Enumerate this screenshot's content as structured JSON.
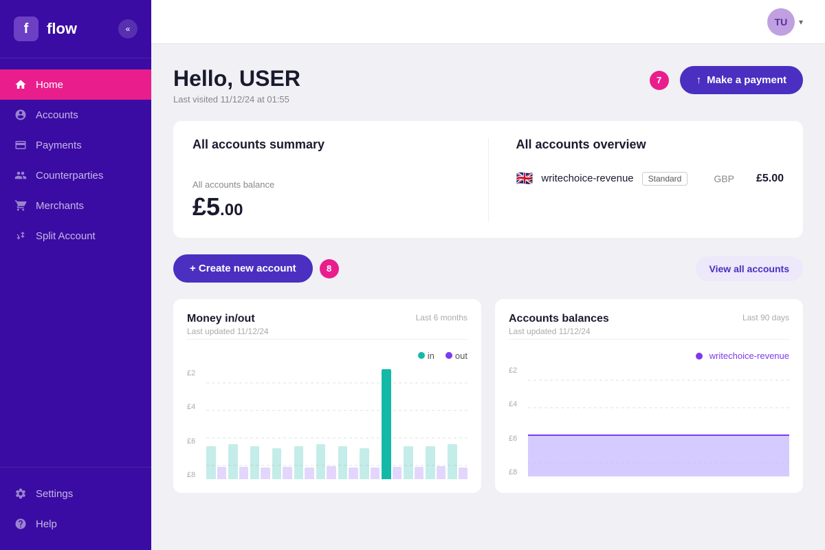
{
  "sidebar": {
    "logo": "f",
    "app_name": "flow",
    "collapse_label": "<<",
    "nav_items": [
      {
        "id": "home",
        "label": "Home",
        "icon": "home",
        "active": true
      },
      {
        "id": "accounts",
        "label": "Accounts",
        "icon": "accounts"
      },
      {
        "id": "payments",
        "label": "Payments",
        "icon": "payments"
      },
      {
        "id": "counterparties",
        "label": "Counterparties",
        "icon": "counterparties"
      },
      {
        "id": "merchants",
        "label": "Merchants",
        "icon": "merchants"
      },
      {
        "id": "split-account",
        "label": "Split Account",
        "icon": "split"
      }
    ],
    "bottom_items": [
      {
        "id": "settings",
        "label": "Settings",
        "icon": "settings"
      },
      {
        "id": "help",
        "label": "Help",
        "icon": "help"
      }
    ]
  },
  "header": {
    "user_initials": "TU",
    "user_chevron": "▾"
  },
  "hero": {
    "greeting": "Hello, USER",
    "last_visited": "Last visited 11/12/24 at 01:55",
    "make_payment_label": "Make a payment",
    "badge_number": "7"
  },
  "summary": {
    "all_accounts_summary_title": "All accounts summary",
    "all_accounts_overview_title": "All accounts overview",
    "balance_label": "All accounts balance",
    "balance_main": "£5",
    "balance_decimal": ".00",
    "accounts": [
      {
        "name": "writechoice-revenue",
        "badge": "Standard",
        "currency": "GBP",
        "balance": "£5.00",
        "flag": "gb"
      }
    ]
  },
  "actions": {
    "create_account_label": "+ Create new account",
    "view_all_label": "View all accounts",
    "badge_number": "8"
  },
  "money_chart": {
    "title": "Money in/out",
    "last_updated": "Last updated 11/12/24",
    "period": "Last 6 months",
    "legend_in": "in",
    "legend_out": "out",
    "y_labels": [
      "£8",
      "£6",
      "£4",
      "£2"
    ],
    "bars": [
      {
        "in_h": 30,
        "out_h": 28
      },
      {
        "in_h": 32,
        "out_h": 28
      },
      {
        "in_h": 30,
        "out_h": 26
      },
      {
        "in_h": 28,
        "out_h": 28
      },
      {
        "in_h": 30,
        "out_h": 27
      },
      {
        "in_h": 32,
        "out_h": 29
      },
      {
        "in_h": 30,
        "out_h": 27
      },
      {
        "in_h": 28,
        "out_h": 26
      },
      {
        "in_h": 100,
        "out_h": 28,
        "highlight": true
      },
      {
        "in_h": 30,
        "out_h": 28
      },
      {
        "in_h": 30,
        "out_h": 29
      },
      {
        "in_h": 32,
        "out_h": 27
      }
    ]
  },
  "balances_chart": {
    "title": "Accounts balances",
    "last_updated": "Last updated 11/12/24",
    "period": "Last 90 days",
    "account_legend": "writechoice-revenue",
    "y_labels": [
      "£8",
      "£6",
      "£4",
      "£2"
    ],
    "fill_color": "#c4b5fd"
  },
  "badges": {
    "colors": {
      "pink": "#e91e8c",
      "purple": "#4a2fc0"
    }
  }
}
